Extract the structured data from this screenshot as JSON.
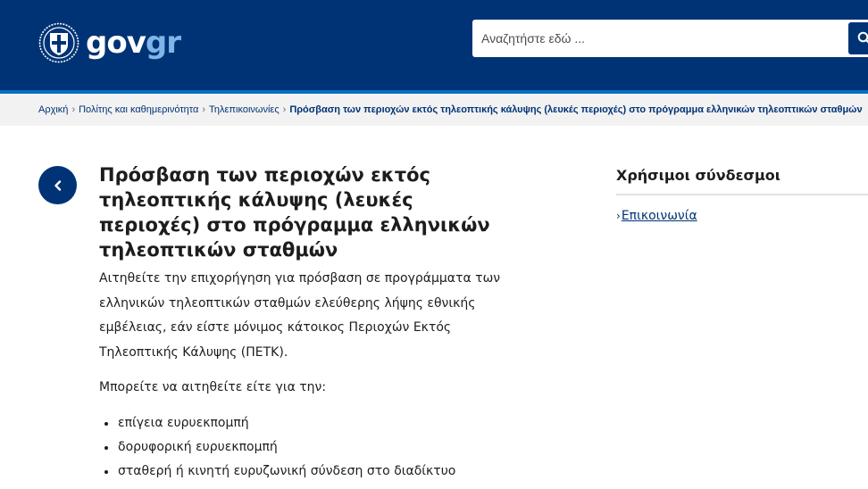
{
  "header": {
    "logo": {
      "gov": "gov",
      "gr": "gr",
      "emblem_icon": "greek-coat-of-arms-icon"
    },
    "search": {
      "placeholder": "Αναζητήστε εδώ ...",
      "value": "",
      "button_icon": "search-icon"
    },
    "colors": {
      "background": "#003375",
      "accent_line": "#046ec5",
      "logo_gr": "#7fb6e8"
    }
  },
  "breadcrumb": {
    "items": [
      "Αρχική",
      "Πολίτης και καθημερινότητα",
      "Τηλεπικοινωνίες"
    ],
    "current": "Πρόσβαση των περιοχών εκτός τηλεοπτικής κάλυψης (λευκές περιοχές) στο πρόγραμμα ελληνικών τηλεοπτικών σταθμών"
  },
  "main": {
    "back_icon": "chevron-left-icon",
    "title": "Πρόσβαση των περιοχών εκτός τηλεοπτικής κάλυψης (λευκές περιοχές) στο πρόγραμμα ελληνικών τηλεοπτικών σταθμών",
    "lead": "Αιτηθείτε την επιχορήγηση για πρόσβαση σε προγράμματα των ελληνικών τηλεοπτικών σταθμών ελεύθερης λήψης εθνικής εμβέλειας, εάν είστε μόνιμος κάτοικος Περιοχών Εκτός Τηλεοπτικής Κάλυψης (ΠΕΤΚ).",
    "paragraph": "Μπορείτε να αιτηθείτε είτε για την:",
    "bullets": [
      "επίγεια ευρυεκπομπή",
      "δορυφορική ευρυεκπομπή",
      "σταθερή ή κινητή ευρυζωνική σύνδεση στο διαδίκτυο"
    ]
  },
  "sidebar": {
    "title": "Χρήσιμοι σύνδεσμοι",
    "links": [
      {
        "label": "Επικοινωνία"
      }
    ]
  }
}
